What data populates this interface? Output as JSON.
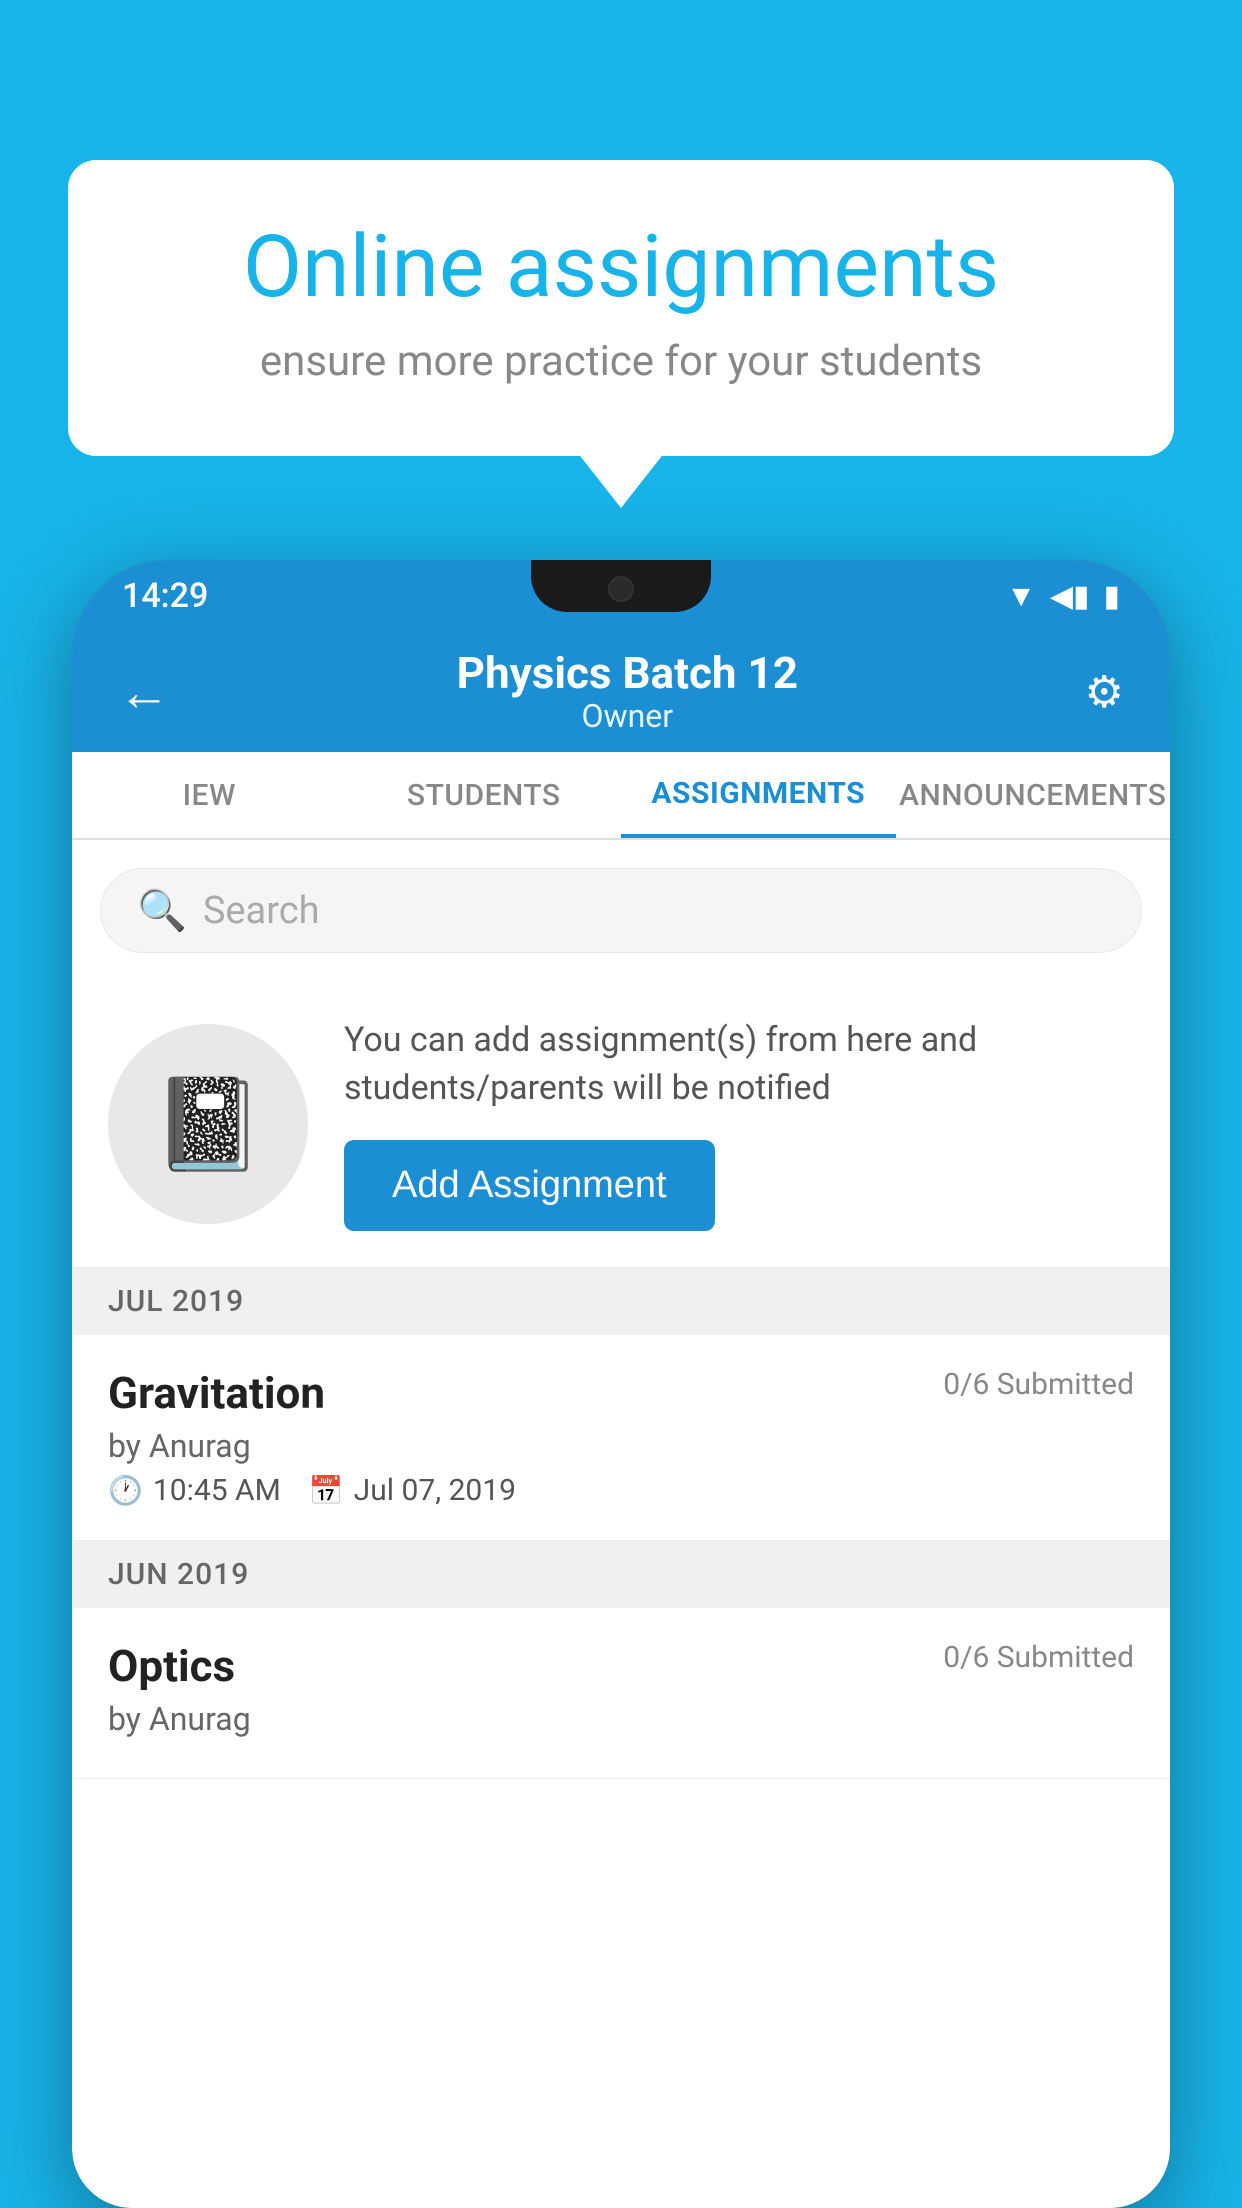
{
  "background_color": "#18b3e8",
  "promo": {
    "title": "Online assignments",
    "subtitle": "ensure more practice for your students"
  },
  "phone": {
    "status_bar": {
      "time": "14:29",
      "icons": [
        "wifi",
        "signal",
        "battery"
      ]
    },
    "app_bar": {
      "title": "Physics Batch 12",
      "subtitle": "Owner",
      "back_label": "←",
      "settings_label": "⚙"
    },
    "tabs": [
      {
        "label": "IEW",
        "active": false
      },
      {
        "label": "STUDENTS",
        "active": false
      },
      {
        "label": "ASSIGNMENTS",
        "active": true
      },
      {
        "label": "ANNOUNCEMENTS",
        "active": false
      }
    ],
    "search": {
      "placeholder": "Search"
    },
    "promo_section": {
      "icon": "📓",
      "text": "You can add assignment(s) from here and students/parents will be notified",
      "button_label": "Add Assignment"
    },
    "sections": [
      {
        "month": "JUL 2019",
        "assignments": [
          {
            "title": "Gravitation",
            "submitted": "0/6 Submitted",
            "author": "by Anurag",
            "time": "10:45 AM",
            "date": "Jul 07, 2019"
          }
        ]
      },
      {
        "month": "JUN 2019",
        "assignments": [
          {
            "title": "Optics",
            "submitted": "0/6 Submitted",
            "author": "by Anurag",
            "time": "",
            "date": ""
          }
        ]
      }
    ]
  }
}
